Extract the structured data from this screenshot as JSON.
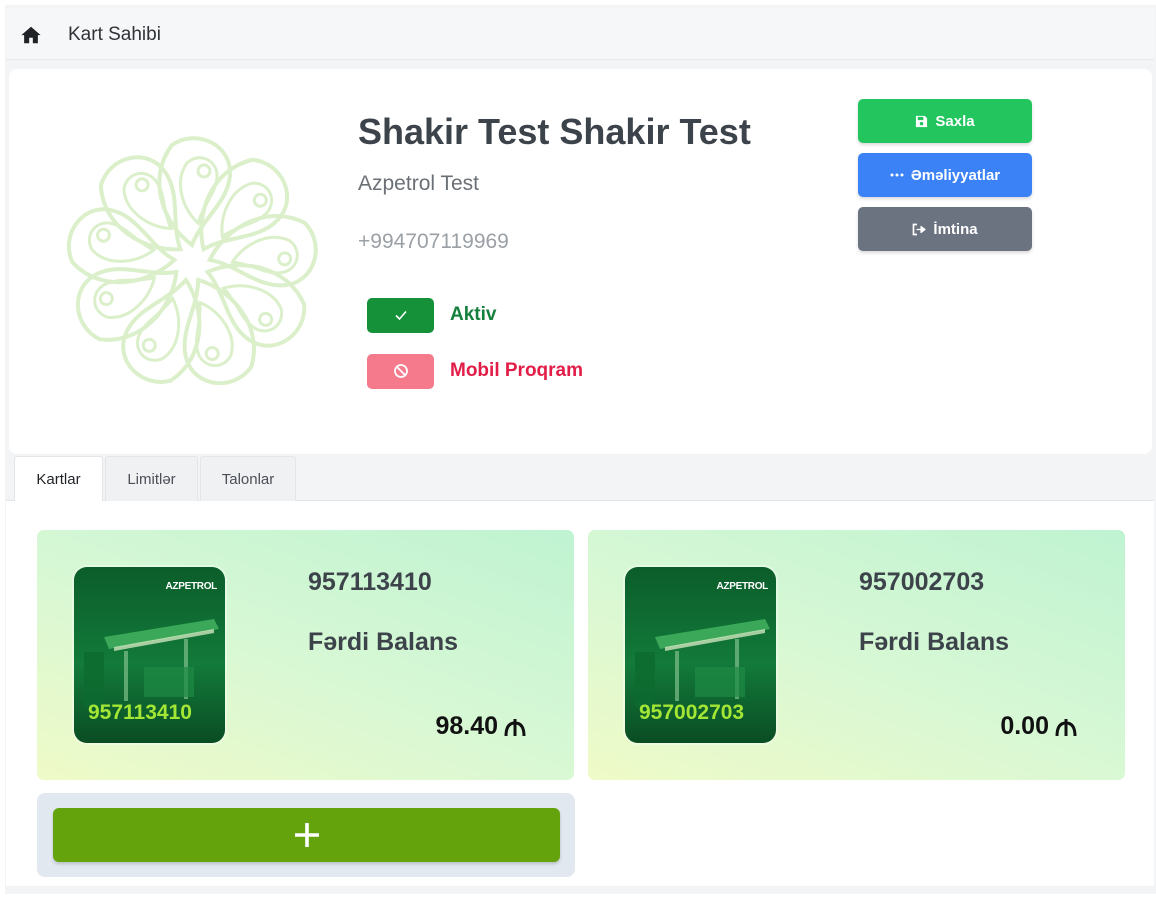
{
  "header": {
    "title": "Kart Sahibi",
    "icon": "home-icon"
  },
  "profile": {
    "name": "Shakir Test Shakir Test",
    "company": "Azpetrol Test",
    "phone": "+994707119969",
    "statuses": [
      {
        "label": "Aktiv",
        "active": true,
        "color": "#15803d",
        "icon": "check-icon"
      },
      {
        "label": "Mobil Proqram",
        "active": false,
        "color": "#e11d48",
        "icon": "ban-icon"
      }
    ]
  },
  "actions": {
    "save_label": "Saxla",
    "operations_label": "Əməliyyatlar",
    "cancel_label": "İmtina"
  },
  "tabs": [
    {
      "label": "Kartlar",
      "active": true
    },
    {
      "label": "Limitlər",
      "active": false
    },
    {
      "label": "Talonlar",
      "active": false
    }
  ],
  "cards": [
    {
      "number": "957113410",
      "thumb_number": "957113410",
      "brand": "AZPETROL",
      "type": "Fərdi Balans",
      "balance": "98.40",
      "currency_icon": "manat-icon"
    },
    {
      "number": "957002703",
      "thumb_number": "957002703",
      "brand": "AZPETROL",
      "type": "Fərdi Balans",
      "balance": "0.00",
      "currency_icon": "manat-icon"
    }
  ],
  "add_card": {
    "icon": "plus-icon"
  },
  "colors": {
    "save": "#22c55e",
    "operations": "#3b82f6",
    "cancel": "#6b7280",
    "add": "#65a30d"
  }
}
